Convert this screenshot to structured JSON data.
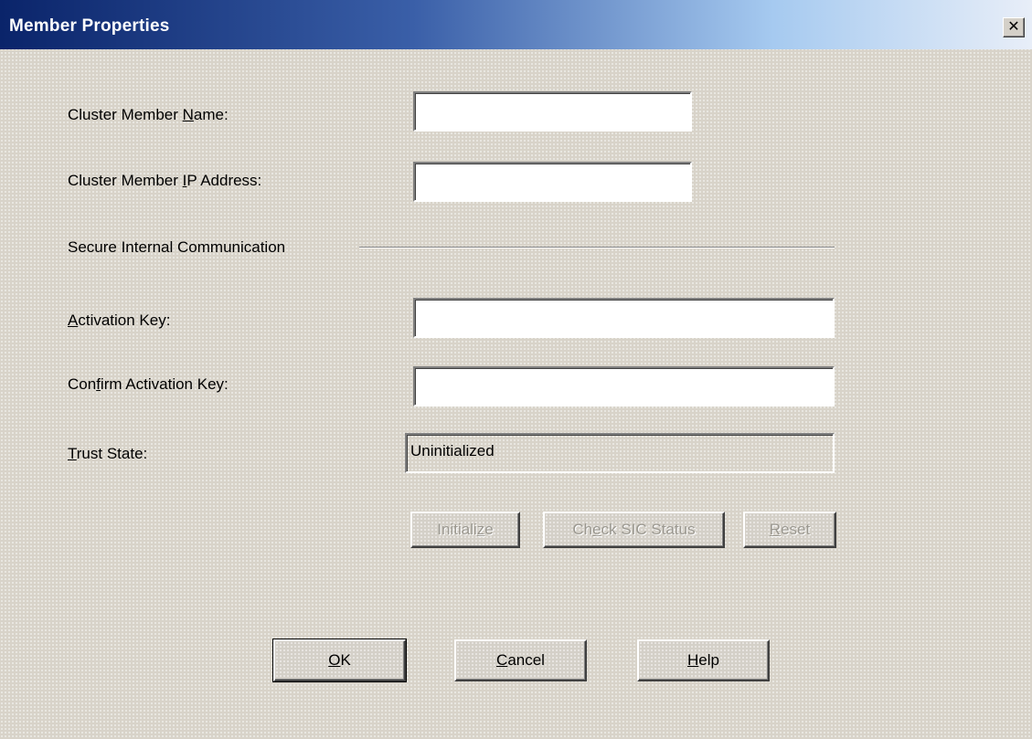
{
  "window": {
    "title": "Member Properties",
    "close_glyph": "✕"
  },
  "form": {
    "name_label": {
      "pre": "Cluster Member ",
      "key": "N",
      "post": "ame:"
    },
    "name_value": "",
    "ip_label": {
      "pre": "Cluster Member ",
      "key": "I",
      "post": "P Address:"
    },
    "ip_value": "",
    "sic_section_label": "Secure Internal Communication",
    "activation_label": {
      "pre": "",
      "key": "A",
      "post": "ctivation Key:"
    },
    "activation_value": "",
    "confirm_label": {
      "pre": "Con",
      "key": "f",
      "post": "irm Activation Key:"
    },
    "confirm_value": "",
    "trust_label": {
      "pre": "",
      "key": "T",
      "post": "rust State:"
    },
    "trust_value": "Uninitialized"
  },
  "sic_buttons": {
    "initialize": {
      "pre": "Initiali",
      "key": "z",
      "post": "e"
    },
    "check": {
      "pre": "Ch",
      "key": "e",
      "post": "ck SIC Status"
    },
    "reset": {
      "pre": "",
      "key": "R",
      "post": "eset"
    }
  },
  "footer": {
    "ok": {
      "pre": "",
      "key": "O",
      "post": "K"
    },
    "cancel": {
      "pre": "",
      "key": "C",
      "post": "ancel"
    },
    "help": {
      "pre": "",
      "key": "H",
      "post": "elp"
    }
  },
  "colors": {
    "title_gradient_start": "#0a246a",
    "title_gradient_end": "#e8eef8",
    "dialog_face": "#d8d3c9",
    "disabled_text": "#9a978f"
  }
}
